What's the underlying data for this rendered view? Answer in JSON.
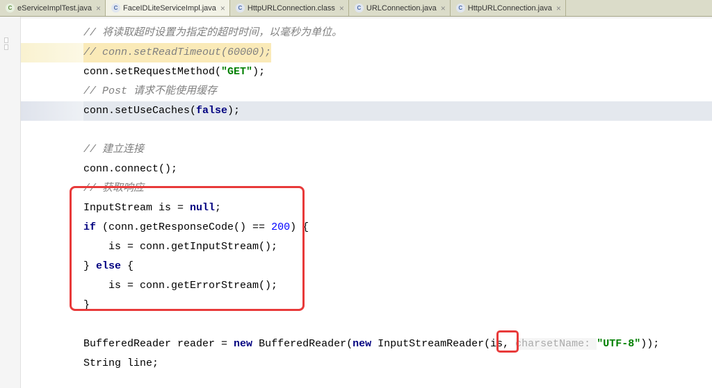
{
  "tabs": [
    {
      "label": "eServiceImplTest.java",
      "active": false,
      "icon": "java-green"
    },
    {
      "label": "FaceIDLiteServiceImpl.java",
      "active": true,
      "icon": "java-blue"
    },
    {
      "label": "HttpURLConnection.class",
      "active": false,
      "icon": "java-blue"
    },
    {
      "label": "URLConnection.java",
      "active": false,
      "icon": "java-blue"
    },
    {
      "label": "HttpURLConnection.java",
      "active": false,
      "icon": "java-blue"
    }
  ],
  "code": {
    "c1": "// 将读取超时设置为指定的超时时间，以毫秒为单位。",
    "c2": "// conn.setReadTimeout(60000);",
    "c3a": "conn.setRequestMethod(",
    "c3b": "\"GET\"",
    "c3c": ");",
    "c4": "// Post 请求不能使用缓存",
    "c5a": "conn.setUseCaches(",
    "c5kw": "false",
    "c5c": ");",
    "c6": "// 建立连接",
    "c7": "conn.connect();",
    "c8": "// 获取响应",
    "c9a": "InputStream is = ",
    "c9kw": "null",
    "c9c": ";",
    "c10a": "if",
    "c10b": " (conn.getResponseCode() == ",
    "c10num": "200",
    "c10c": ") {",
    "c11": "    is = conn.getInputStream();",
    "c12a": "} ",
    "c12kw": "else",
    "c12b": " {",
    "c13": "    is = conn.getErrorStream();",
    "c14": "}",
    "c15a": "BufferedReader reader = ",
    "c15new1": "new",
    "c15b": " BufferedReader(",
    "c15new2": "new",
    "c15c": " InputStreamReader(is, ",
    "c15hint": "charsetName: ",
    "c15str": "\"UTF-8\"",
    "c15d": "));",
    "c16": "String line;"
  }
}
